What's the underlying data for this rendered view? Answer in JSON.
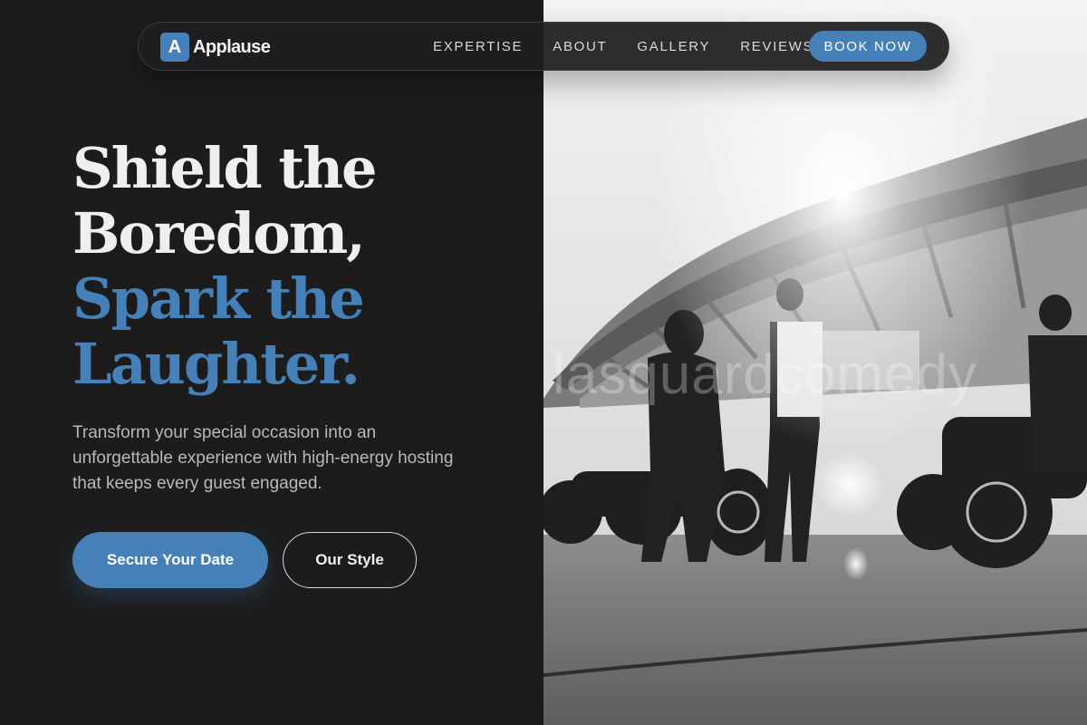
{
  "brand": {
    "logo_letter": "A",
    "name": "Applause",
    "accent_color": "#4581b8"
  },
  "nav": {
    "links": [
      "EXPERTISE",
      "ABOUT",
      "GALLERY",
      "REVIEWS"
    ],
    "cta_label": "BOOK NOW"
  },
  "hero": {
    "headline_lines": [
      "Shield the",
      "Boredom,",
      "Spark the",
      "Laughter."
    ],
    "subtext": "Transform your special occasion into an unforgettable experience with high-energy hosting that keeps every guest engaged.",
    "primary_cta": "Secure Your Date",
    "secondary_cta": "Our Style"
  },
  "photo": {
    "description_icon": "photo-motorcycles-stadium",
    "watermark": "lasquardcomedy"
  }
}
